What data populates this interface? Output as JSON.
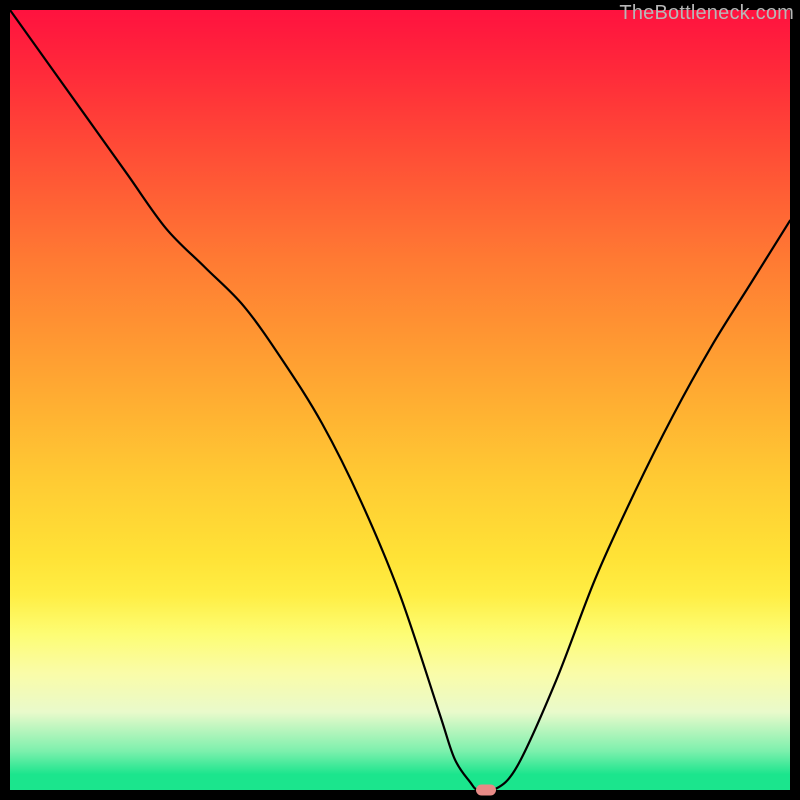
{
  "watermark": {
    "text": "TheBottleneck.com"
  },
  "chart_data": {
    "type": "line",
    "title": "",
    "xlabel": "",
    "ylabel": "",
    "xlim": [
      0,
      100
    ],
    "ylim": [
      0,
      100
    ],
    "grid": false,
    "legend": false,
    "x": [
      0,
      5,
      10,
      15,
      20,
      25,
      30,
      35,
      40,
      45,
      50,
      55,
      57,
      59,
      60,
      62,
      65,
      70,
      75,
      80,
      85,
      90,
      95,
      100
    ],
    "values": [
      100,
      93,
      86,
      79,
      72,
      67,
      62,
      55,
      47,
      37,
      25,
      10,
      4,
      1,
      0,
      0,
      3,
      14,
      27,
      38,
      48,
      57,
      65,
      73
    ],
    "series_name": "bottleneck",
    "marker": {
      "x": 61,
      "y": 0
    },
    "background_gradient": [
      {
        "stop": 0,
        "color": "#ff123f"
      },
      {
        "stop": 50,
        "color": "#ffca33"
      },
      {
        "stop": 80,
        "color": "#fdfd74"
      },
      {
        "stop": 100,
        "color": "#1be58d"
      }
    ]
  }
}
